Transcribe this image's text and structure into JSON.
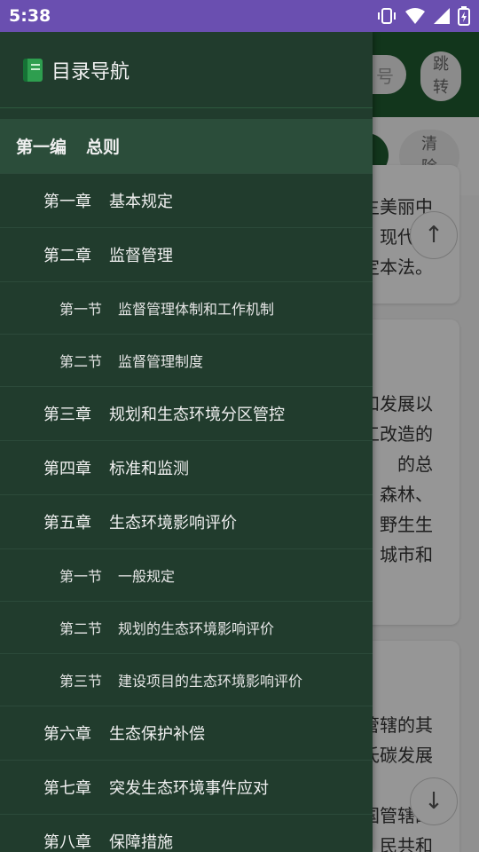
{
  "status_bar": {
    "time": "5:38"
  },
  "background_app": {
    "search_placeholder_fragment": "号",
    "jump_button": [
      "跳",
      "转"
    ],
    "clear_button": [
      "清",
      "除"
    ],
    "card1_lines": [
      "生美丽中",
      "现代化",
      "定本法。"
    ],
    "card2_lines": [
      "和发展以",
      "工改造的",
      "的总",
      "森林、",
      "野生生",
      "城市和"
    ],
    "card3_lines": [
      "管辖的其",
      "氏碳发展",
      "国管辖的",
      "民共和"
    ]
  },
  "drawer": {
    "title": "目录导航",
    "items": [
      {
        "level": "part",
        "num": "第一编",
        "title": "总则"
      },
      {
        "level": "chapter",
        "num": "第一章",
        "title": "基本规定"
      },
      {
        "level": "chapter",
        "num": "第二章",
        "title": "监督管理"
      },
      {
        "level": "section",
        "num": "第一节",
        "title": "监督管理体制和工作机制"
      },
      {
        "level": "section",
        "num": "第二节",
        "title": "监督管理制度"
      },
      {
        "level": "chapter",
        "num": "第三章",
        "title": "规划和生态环境分区管控"
      },
      {
        "level": "chapter",
        "num": "第四章",
        "title": "标准和监测"
      },
      {
        "level": "chapter",
        "num": "第五章",
        "title": "生态环境影响评价"
      },
      {
        "level": "section",
        "num": "第一节",
        "title": "一般规定"
      },
      {
        "level": "section",
        "num": "第二节",
        "title": "规划的生态环境影响评价"
      },
      {
        "level": "section",
        "num": "第三节",
        "title": "建设项目的生态环境影响评价"
      },
      {
        "level": "chapter",
        "num": "第六章",
        "title": "生态保护补偿"
      },
      {
        "level": "chapter",
        "num": "第七章",
        "title": "突发生态环境事件应对"
      },
      {
        "level": "chapter",
        "num": "第八章",
        "title": "保障措施"
      }
    ]
  },
  "colors": {
    "status_bar": "#6a4fb0",
    "drawer_bg": "#213c2d",
    "part_row_bg": "#2b4d3a",
    "app_green": "#1f5a2f"
  }
}
